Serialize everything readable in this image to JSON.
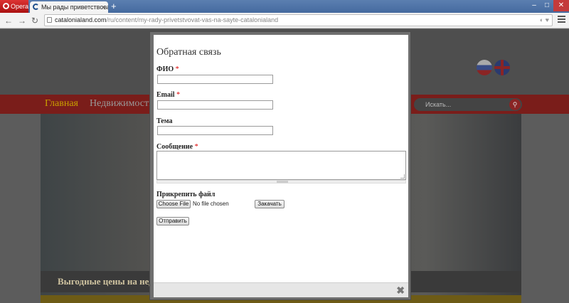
{
  "browser": {
    "app_name": "Opera",
    "tab_title": "Мы рады приветствовать",
    "tab_close": "×",
    "new_tab": "+",
    "url_host": "catalonialand.com",
    "url_path": "/ru/content/my-rady-privetstvovat-vas-na-sayte-catalonialand",
    "window_controls": {
      "minimize": "–",
      "maximize": "□",
      "close": "✕"
    },
    "nav": {
      "back": "←",
      "forward": "→",
      "reload": "↻"
    },
    "url_icons": "◐ ♥"
  },
  "site": {
    "nav_items": [
      "Главная",
      "Недвижимость"
    ],
    "search_placeholder": "Искать...",
    "hero_caption": "Выгодные цены на нед",
    "flags": [
      "flag-ru",
      "flag-en"
    ]
  },
  "form": {
    "title": "Обратная связь",
    "required_mark": "*",
    "fields": {
      "name_label": "ФИО",
      "name_value": "",
      "email_label": "Email",
      "email_value": "",
      "subject_label": "Тема",
      "subject_value": "",
      "message_label": "Сообщение",
      "message_value": ""
    },
    "attach_label": "Прикрепить файл",
    "choose_file_button": "Choose File",
    "file_status": "No file chosen",
    "upload_button": "Закачать",
    "submit_button": "Отправить",
    "close_icon": "✖"
  }
}
